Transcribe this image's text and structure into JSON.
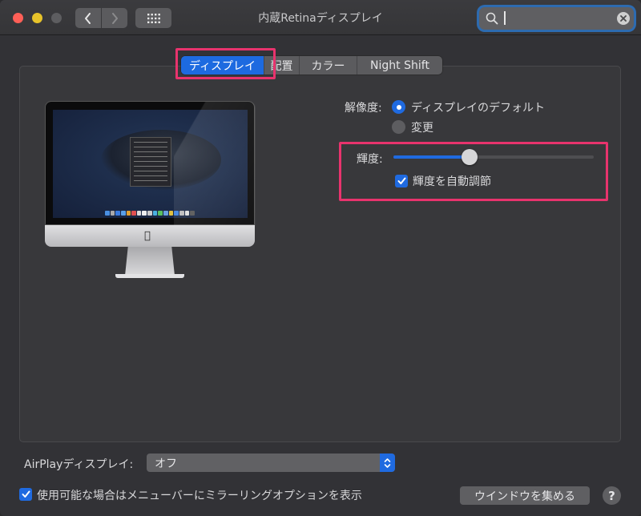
{
  "window": {
    "title": "内蔵Retinaディスプレイ",
    "traffic_lights": {
      "close_color": "#fe5f57",
      "minimize_color": "#e7c32a",
      "zoom_color": "#5d5d60"
    },
    "toolbar": {
      "back_icon": "chevron-left-icon",
      "forward_icon": "chevron-right-icon",
      "show_all_icon": "grid-icon"
    },
    "search": {
      "value": "",
      "search_icon": "magnifier-icon",
      "clear_icon": "clear-circle-icon"
    }
  },
  "tabs": [
    {
      "label": "ディスプレイ",
      "active": true
    },
    {
      "label": "配置",
      "active": false
    },
    {
      "label": "カラー",
      "active": false
    },
    {
      "label": "Night Shift",
      "active": false
    }
  ],
  "display": {
    "resolution": {
      "label": "解像度:",
      "options": [
        {
          "label": "ディスプレイのデフォルト",
          "selected": true
        },
        {
          "label": "変更",
          "selected": false
        }
      ]
    },
    "brightness": {
      "label": "輝度:",
      "value_percent": 38,
      "auto_adjust": {
        "label": "輝度を自動調節",
        "checked": true
      }
    }
  },
  "footer": {
    "airplay": {
      "label": "AirPlayディスプレイ:",
      "value": "オフ"
    },
    "mirroring_option": {
      "label": "使用可能な場合はメニューバーにミラーリングオプションを表示",
      "checked": true
    },
    "gather_windows_label": "ウインドウを集める",
    "help_label": "?"
  },
  "colors": {
    "accent": "#1f6ae0",
    "highlight_annotation": "#e8336d",
    "search_focus_ring": "#2d6bb0"
  }
}
